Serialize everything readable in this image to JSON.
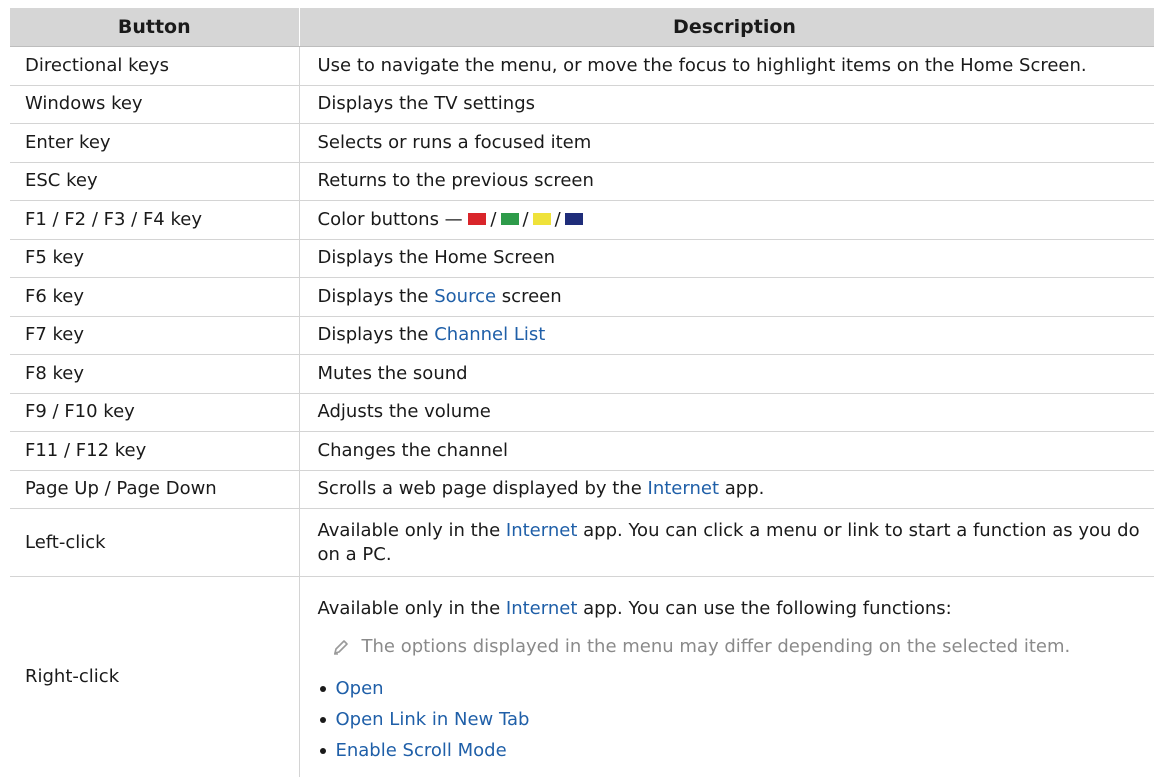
{
  "table": {
    "header": {
      "button": "Button",
      "description": "Description"
    },
    "rows": [
      {
        "button": "Directional keys",
        "desc": "Use to navigate the menu, or move the focus to highlight items on the Home Screen."
      },
      {
        "button": "Windows key",
        "desc": "Displays the TV settings"
      },
      {
        "button": "Enter key",
        "desc": "Selects or runs a focused item"
      },
      {
        "button": "ESC key",
        "desc": "Returns to the previous screen"
      },
      {
        "button": "F1 / F2 / F3 / F4 key",
        "desc_prefix": "Color buttons —",
        "separator": "/"
      },
      {
        "button": "F5 key",
        "desc": "Displays the Home Screen"
      },
      {
        "button": "F6 key",
        "desc_before": "Displays the",
        "link": "Source",
        "desc_after": "screen"
      },
      {
        "button": "F7 key",
        "desc_before": "Displays the",
        "link": "Channel List"
      },
      {
        "button": "F8 key",
        "desc": "Mutes the sound"
      },
      {
        "button": "F9 / F10 key",
        "desc": "Adjusts the volume"
      },
      {
        "button": "F11 / F12 key",
        "desc": "Changes the channel"
      },
      {
        "button": "Page Up / Page Down",
        "desc_before": "Scrolls a web page displayed by the",
        "link": "Internet",
        "desc_after": "app."
      },
      {
        "button": "Left-click",
        "desc_before": "Available only in the",
        "link": "Internet",
        "desc_after": "app. You can click a menu or link to start a function as you do on a PC."
      },
      {
        "button": "Right-click",
        "desc_before": "Available only in the",
        "link": "Internet",
        "desc_after": "app. You can use the following functions:",
        "note": "The options displayed in the menu may differ depending on the selected item.",
        "functions": [
          "Open",
          "Open Link in New Tab",
          "Enable Scroll Mode"
        ]
      }
    ]
  },
  "colors": {
    "red": "#d9252a",
    "green": "#2e9b4a",
    "yellow": "#efe23a",
    "blue": "#1f2d7a",
    "link": "#1f5fa8",
    "header_bg": "#d6d6d6"
  },
  "icons": {
    "note": "pencil-icon"
  }
}
